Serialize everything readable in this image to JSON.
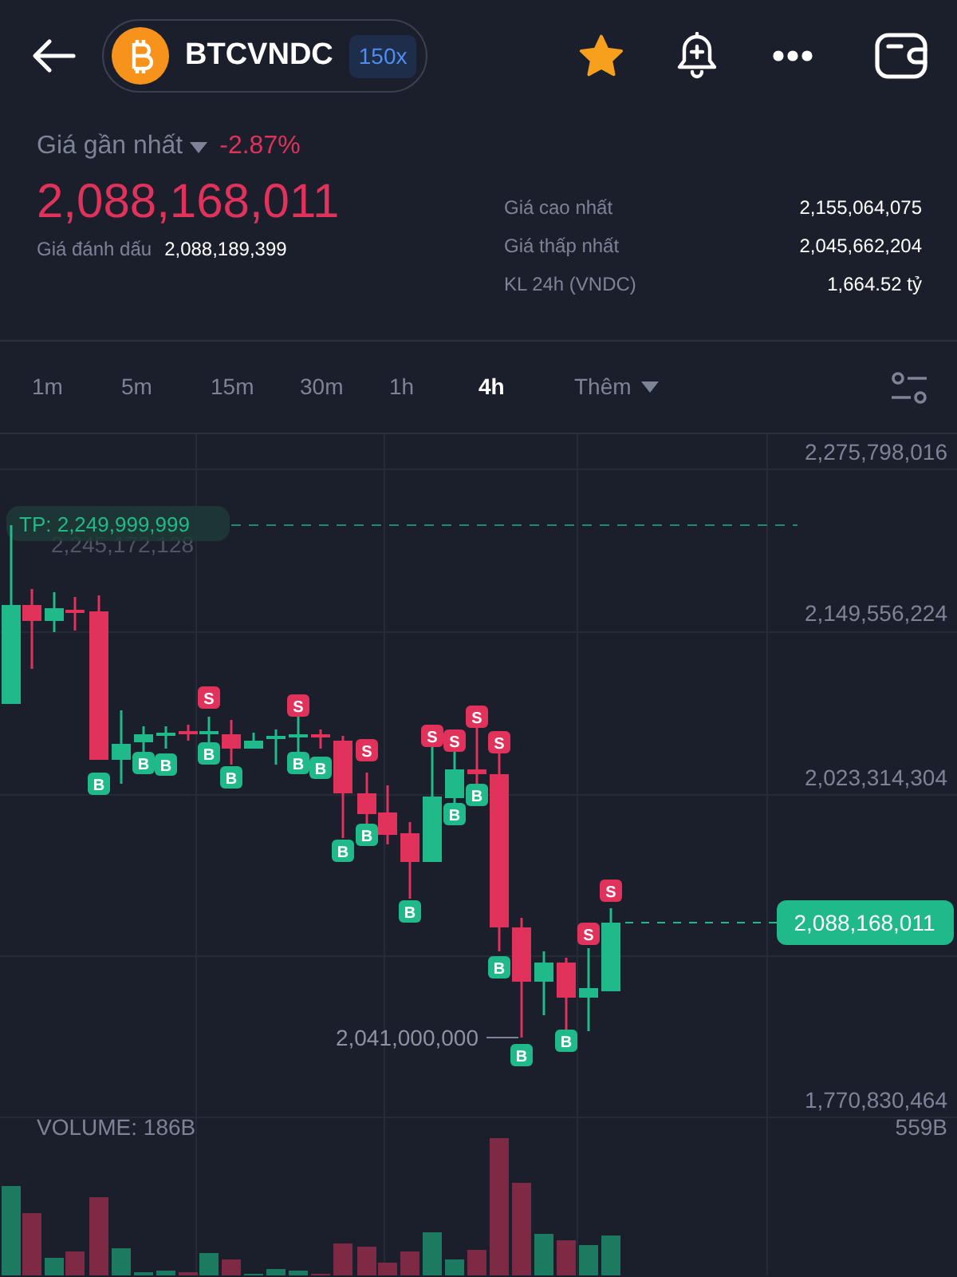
{
  "pair": {
    "symbol": "BTCVNDC",
    "leverage": "150x",
    "favorited": true
  },
  "price": {
    "label": "Giá gần nhất",
    "change": "-2.87%",
    "negative": true,
    "last": "2,088,168,011",
    "mark_label": "Giá đánh dấu",
    "mark": "2,088,189,399"
  },
  "stats": [
    {
      "label": "Giá cao nhất",
      "value": "2,155,064,075"
    },
    {
      "label": "Giá thấp nhất",
      "value": "2,045,662,204"
    },
    {
      "label": "KL 24h (VNDC)",
      "value": "1,664.52 tỷ"
    }
  ],
  "intervals": [
    {
      "label": "1m",
      "selected": false
    },
    {
      "label": "5m",
      "selected": false
    },
    {
      "label": "15m",
      "selected": false
    },
    {
      "label": "30m",
      "selected": false
    },
    {
      "label": "1h",
      "selected": false
    },
    {
      "label": "4h",
      "selected": true
    }
  ],
  "more": "Thêm",
  "chart": {
    "y_ticks": [
      "2,275,798,016",
      "2,149,556,224",
      "2,023,314,304",
      "1,770,830,464"
    ],
    "tp_label": "TP: 2,249,999,999",
    "ghost_label": "2,245,172,128",
    "low_label": "2,041,000,000",
    "price_tag": "2,088,168,011",
    "volume_label": "VOLUME: 186B",
    "volume_max": "559B",
    "candles": [
      {
        "kind": "up"
      },
      {
        "kind": "down"
      },
      {
        "kind": "up"
      },
      {
        "kind": "down"
      },
      {
        "kind": "down",
        "mark_below": "B"
      },
      {
        "kind": "up"
      },
      {
        "kind": "up",
        "mark_below": "B"
      },
      {
        "kind": "up",
        "mark_below": "B"
      },
      {
        "kind": "down"
      },
      {
        "kind": "up",
        "mark_above": "S",
        "mark_below": "B"
      },
      {
        "kind": "down",
        "mark_below": "B"
      },
      {
        "kind": "up"
      },
      {
        "kind": "up"
      },
      {
        "kind": "up",
        "mark_above": "S",
        "mark_below": "B"
      },
      {
        "kind": "down",
        "mark_below": "B"
      },
      {
        "kind": "down",
        "mark_below": "B"
      },
      {
        "kind": "down",
        "mark_above": "S",
        "mark_below": "B"
      },
      {
        "kind": "down"
      },
      {
        "kind": "down",
        "mark_below": "B"
      },
      {
        "kind": "up",
        "mark_above": "S"
      },
      {
        "kind": "up",
        "mark_above": "S",
        "mark_below": "B"
      },
      {
        "kind": "down",
        "mark_above": "S",
        "mark_below": "B"
      },
      {
        "kind": "down",
        "mark_above": "S",
        "mark_below": "B"
      },
      {
        "kind": "down",
        "mark_below": "B"
      },
      {
        "kind": "up"
      },
      {
        "kind": "down",
        "mark_below": "B"
      },
      {
        "kind": "up",
        "mark_above": "S"
      },
      {
        "kind": "up",
        "mark_above": "S"
      }
    ]
  }
}
